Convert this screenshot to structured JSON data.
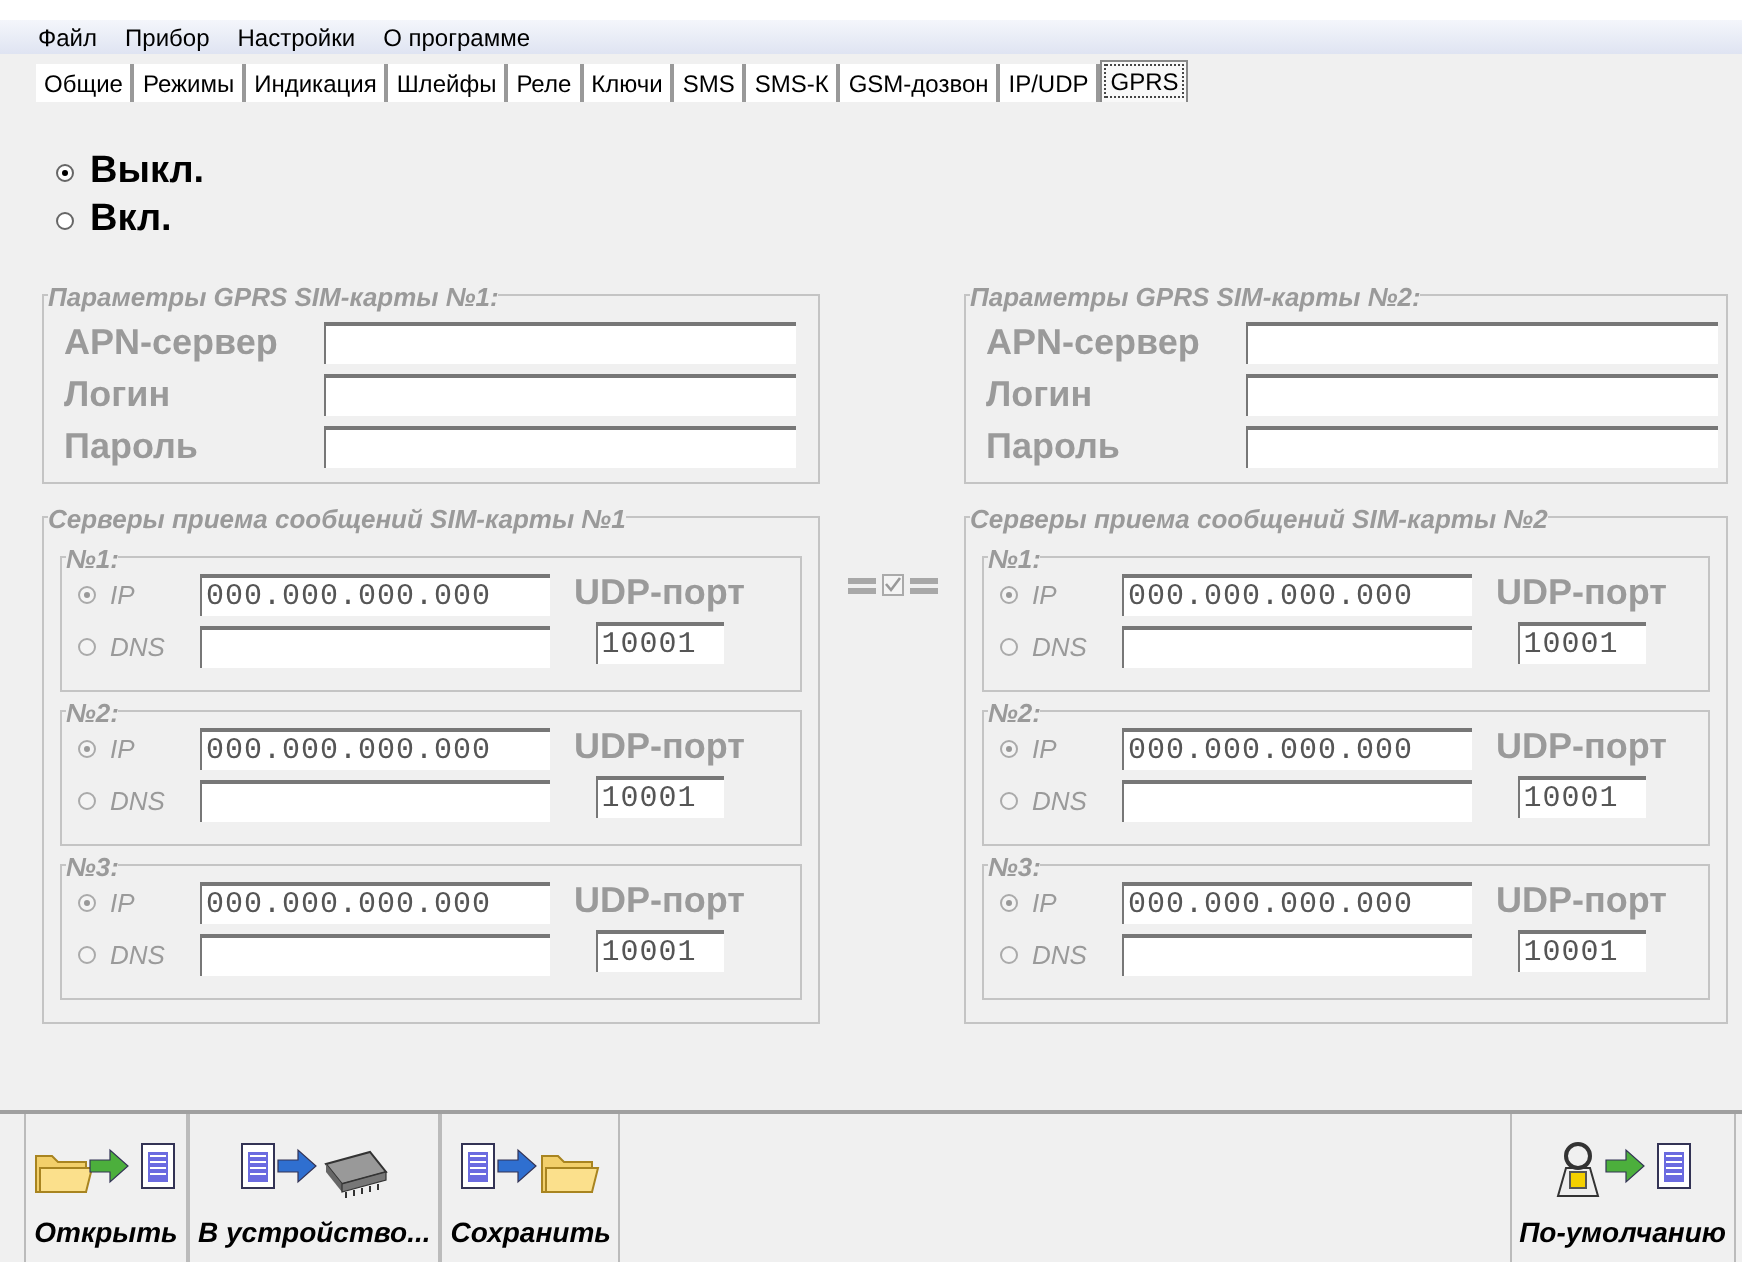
{
  "menu": [
    "Файл",
    "Прибор",
    "Настройки",
    "О программе"
  ],
  "tabs": [
    {
      "label": "Общие",
      "selected": false
    },
    {
      "label": "Режимы",
      "selected": false
    },
    {
      "label": "Индикация",
      "selected": false
    },
    {
      "label": "Шлейфы",
      "selected": false
    },
    {
      "label": "Реле",
      "selected": false
    },
    {
      "label": "Ключи",
      "selected": false
    },
    {
      "label": "SMS",
      "selected": false
    },
    {
      "label": "SMS-К",
      "selected": false
    },
    {
      "label": "GSM-дозвон",
      "selected": false
    },
    {
      "label": "IP/UDP",
      "selected": false
    },
    {
      "label": "GPRS",
      "selected": true
    }
  ],
  "mode_options": [
    {
      "label": "Выкл.",
      "selected": true
    },
    {
      "label": "Вкл.",
      "selected": false
    }
  ],
  "sims": [
    {
      "disabled": true,
      "params": {
        "title": "Параметры GPRS SIM-карты №1:",
        "fields": [
          {
            "label": "APN-сервер"
          },
          {
            "label": "Логин"
          },
          {
            "label": "Пароль"
          }
        ]
      },
      "servers": {
        "title": "Серверы приема сообщений SIM-карты №1",
        "entries": [
          {
            "title": "№1:",
            "options": [
              {
                "label": "IP",
                "selected": true,
                "value": "000.000.000.000"
              },
              {
                "label": "DNS",
                "selected": false
              }
            ],
            "port_label": "UDP-порт",
            "port": "10001"
          },
          {
            "title": "№2:",
            "options": [
              {
                "label": "IP",
                "selected": true,
                "value": "000.000.000.000"
              },
              {
                "label": "DNS",
                "selected": false
              }
            ],
            "port_label": "UDP-порт",
            "port": "10001"
          },
          {
            "title": "№3:",
            "options": [
              {
                "label": "IP",
                "selected": true,
                "value": "000.000.000.000"
              },
              {
                "label": "DNS",
                "selected": false
              }
            ],
            "port_label": "UDP-порт",
            "port": "10001"
          }
        ]
      }
    },
    {
      "disabled": true,
      "params": {
        "title": "Параметры GPRS SIM-карты №2:",
        "fields": [
          {
            "label": "APN-сервер"
          },
          {
            "label": "Логин"
          },
          {
            "label": "Пароль"
          }
        ]
      },
      "servers": {
        "title": "Серверы приема сообщений SIM-карты №2",
        "entries": [
          {
            "title": "№1:",
            "options": [
              {
                "label": "IP",
                "selected": true,
                "value": "000.000.000.000"
              },
              {
                "label": "DNS",
                "selected": false
              }
            ],
            "port_label": "UDP-порт",
            "port": "10001"
          },
          {
            "title": "№2:",
            "options": [
              {
                "label": "IP",
                "selected": true,
                "value": "000.000.000.000"
              },
              {
                "label": "DNS",
                "selected": false
              }
            ],
            "port_label": "UDP-порт",
            "port": "10001"
          },
          {
            "title": "№3:",
            "options": [
              {
                "label": "IP",
                "selected": true,
                "value": "000.000.000.000"
              },
              {
                "label": "DNS",
                "selected": false
              }
            ],
            "port_label": "UDP-порт",
            "port": "10001"
          }
        ]
      }
    }
  ],
  "link_checkbox": {
    "checked": true,
    "disabled": true
  },
  "toolbar": [
    {
      "kind": "open",
      "label": "Открыть"
    },
    {
      "kind": "upload",
      "label": "В устройство..."
    },
    {
      "kind": "save",
      "label": "Сохранить"
    },
    {
      "kind": "defaults",
      "label": "По-умолчанию"
    }
  ]
}
